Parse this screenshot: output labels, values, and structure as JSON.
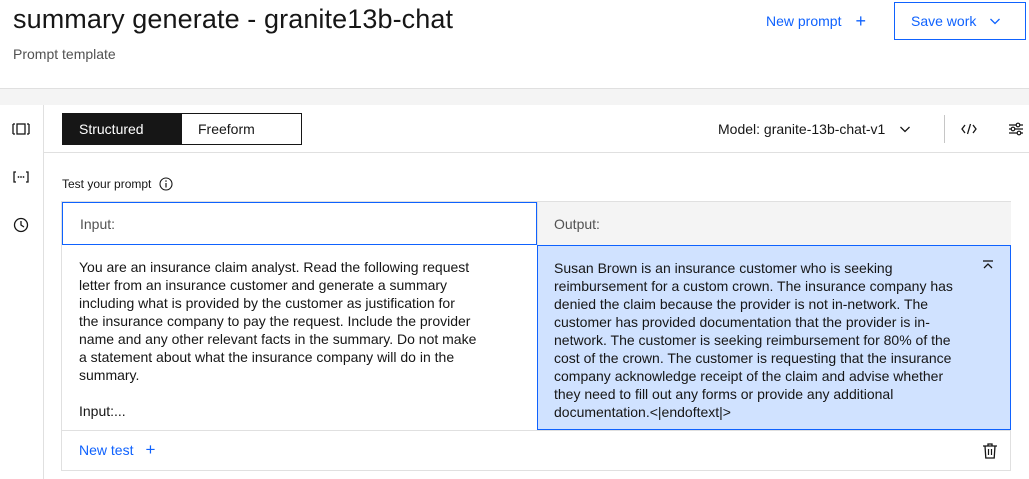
{
  "header": {
    "title": "summary generate - granite13b-chat",
    "subtitle": "Prompt template",
    "new_prompt_label": "New prompt",
    "save_work_label": "Save work"
  },
  "side_rail": {
    "icons": [
      "compare-icon",
      "variables-icon",
      "history-icon"
    ]
  },
  "toolbar": {
    "modes": [
      {
        "label": "Structured",
        "selected": true
      },
      {
        "label": "Freeform",
        "selected": false
      }
    ],
    "model_label": "Model: granite-13b-chat-v1",
    "icons": [
      "code-icon",
      "settings-sliders-icon"
    ]
  },
  "test": {
    "label": "Test your prompt",
    "input_label": "Input:",
    "output_label": "Output:",
    "input_text": "You are an insurance claim analyst. Read the following request\nletter from an insurance customer and generate a summary\nincluding what is provided by the customer as justification for\nthe insurance company to pay the request. Include the provider\nname and any other relevant facts in the summary. Do not make\na statement about what the insurance company will do in the\nsummary.\n\nInput:...",
    "output_text": "Susan Brown is an insurance customer who is seeking reimbursement for a custom crown. The insurance company has denied the claim because the provider is not in-network. The customer has provided documentation that the provider is in-network. The customer is seeking reimbursement for 80% of the cost of the crown. The customer is requesting that the insurance company acknowledge receipt of the claim and advise whether they need to fill out any forms or provide any additional documentation.<|endoftext|>",
    "new_test_label": "New test"
  },
  "colors": {
    "accent": "#0f62fe",
    "output_highlight": "#d0e2ff",
    "selected_toggle": "#161616"
  }
}
